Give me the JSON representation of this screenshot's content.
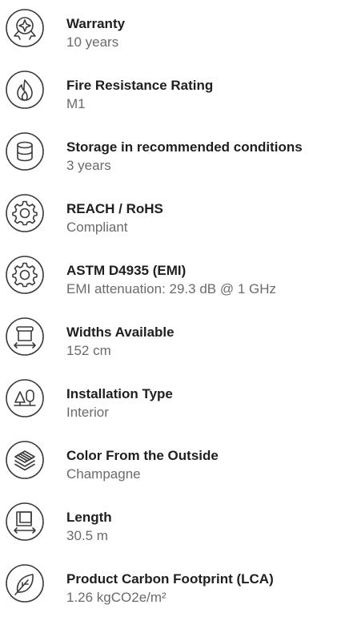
{
  "specs": [
    {
      "icon": "warranty-badge-icon",
      "title": "Warranty",
      "value": "10 years"
    },
    {
      "icon": "flame-icon",
      "title": "Fire Resistance Rating",
      "value": "M1"
    },
    {
      "icon": "database-icon",
      "title": "Storage in recommended conditions",
      "value": "3 years"
    },
    {
      "icon": "gear-icon",
      "title": "REACH / RoHS",
      "value": "Compliant"
    },
    {
      "icon": "gear-icon",
      "title": "ASTM D4935 (EMI)",
      "value": "EMI attenuation: 29.3 dB @ 1 GHz"
    },
    {
      "icon": "roll-width-icon",
      "title": "Widths Available",
      "value": "152 cm"
    },
    {
      "icon": "tree-interior-icon",
      "title": "Installation Type",
      "value": "Interior"
    },
    {
      "icon": "layers-icon",
      "title": "Color From the Outside",
      "value": "Champagne"
    },
    {
      "icon": "length-measure-icon",
      "title": "Length",
      "value": "30.5 m"
    },
    {
      "icon": "leaf-icon",
      "title": "Product Carbon Footprint (LCA)",
      "value": "1.26 kgCO2e/m²"
    }
  ]
}
